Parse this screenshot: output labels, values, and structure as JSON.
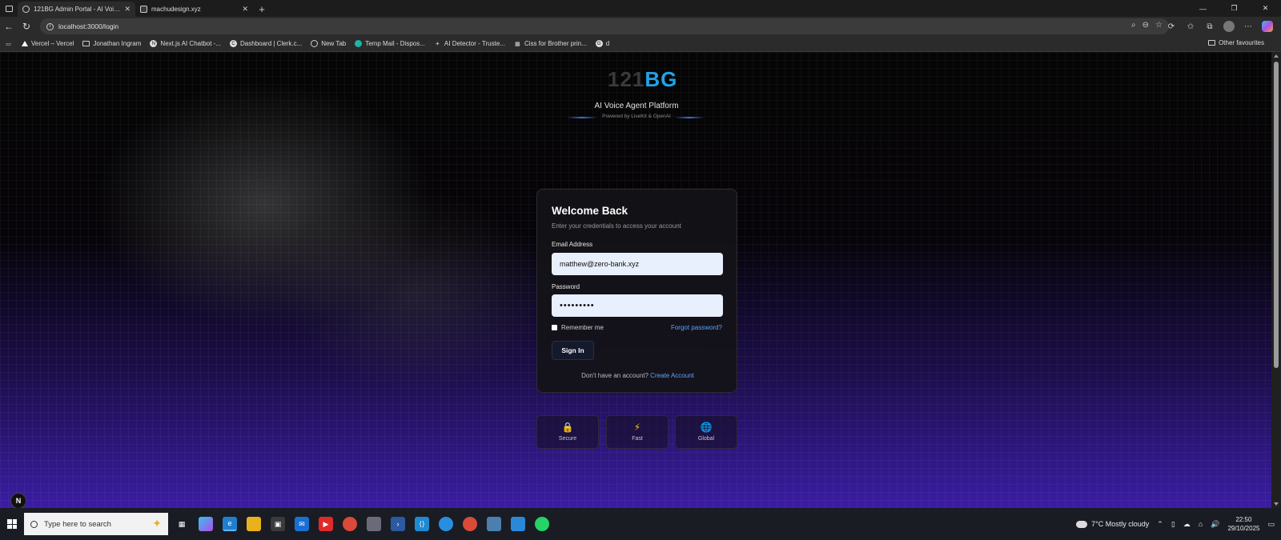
{
  "browser": {
    "tabs": [
      {
        "title": "121BG Admin Portal - AI Voice A...",
        "active": true
      },
      {
        "title": "machudesign.xyz",
        "active": false
      }
    ],
    "url": "localhost:3000/login",
    "bookmarks": [
      "Vercel – Vercel",
      "Jonathan Ingram",
      "Next.js AI Chatbot -...",
      "Dashboard | Clerk.c...",
      "New Tab",
      "Temp Mail - Dispos...",
      "AI Detector - Truste...",
      "Ciss for Brother prin...",
      "d"
    ],
    "other_favourites": "Other favourites"
  },
  "brand": {
    "logo_part1": "121",
    "logo_part2": "BG",
    "tagline": "AI Voice Agent Platform",
    "powered": "Powered by LiveKit & OpenAI",
    "logo_primary_color": "#1ea4e9"
  },
  "login": {
    "title": "Welcome Back",
    "subtitle": "Enter your credentials to access your account",
    "email_label": "Email Address",
    "email_value": "matthew@zero-bank.xyz",
    "password_label": "Password",
    "password_value": "•••••••••",
    "remember_label": "Remember me",
    "forgot_label": "Forgot password?",
    "signin_label": "Sign In",
    "no_account_text": "Don't have an account?",
    "create_account_label": "Create Account"
  },
  "features": [
    {
      "label": "Secure",
      "icon": "lock-icon"
    },
    {
      "label": "Fast",
      "icon": "lightning-icon"
    },
    {
      "label": "Global",
      "icon": "globe-icon"
    }
  ],
  "next_badge": "N",
  "taskbar": {
    "search_placeholder": "Type here to search",
    "weather": "7°C  Mostly cloudy",
    "time": "22:50",
    "date": "29/10/2025"
  }
}
